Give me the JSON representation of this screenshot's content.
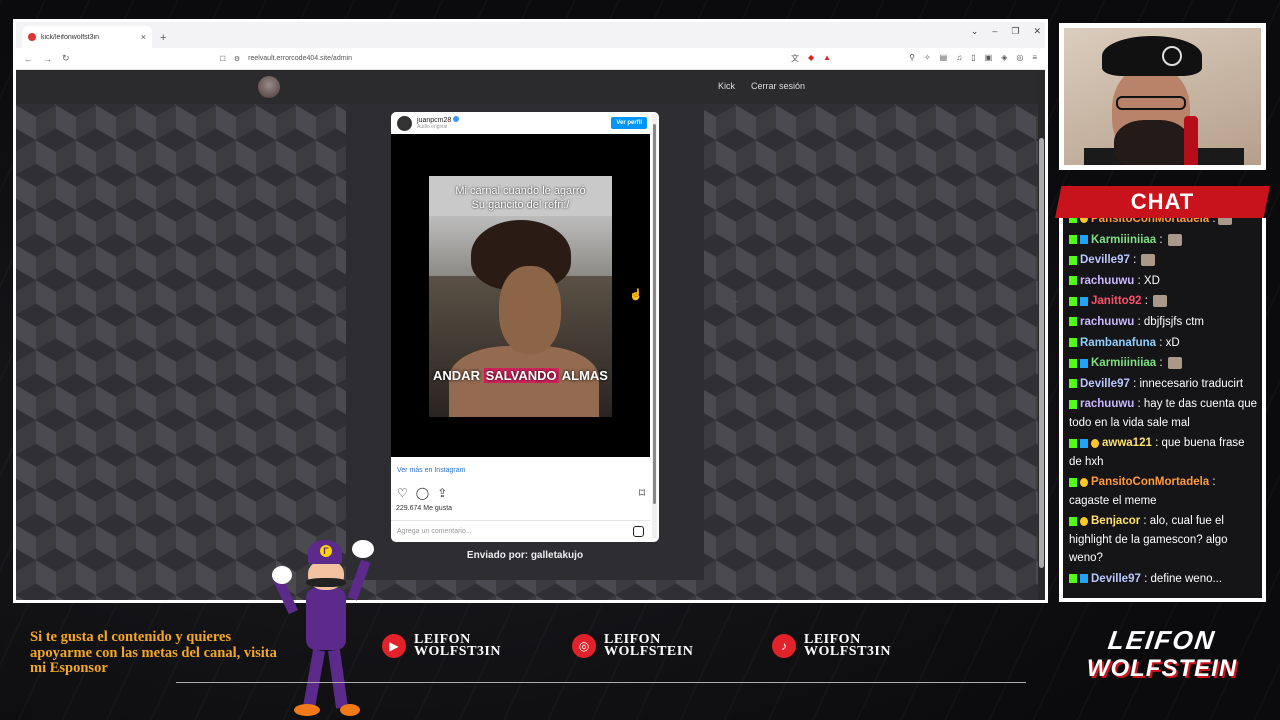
{
  "browser": {
    "tab_title": "kick/leifonwolfst3in",
    "url": "reelvault.errorcode404.site/admin",
    "new_tab": "+",
    "tab_close": "×"
  },
  "site": {
    "nav": [
      {
        "label": "Kick"
      },
      {
        "label": "Cerrar sesión"
      }
    ],
    "arrow_prev": "←",
    "arrow_next": "→",
    "sent_by": "Enviado por: galletakujo"
  },
  "instagram_embed": {
    "username": "juanpcm28",
    "audio": "Audio original",
    "view_profile": "Ver perfil",
    "caption_top_line1": "Mi carnal cuando le agarró",
    "caption_top_line2": "Su gancito del refri:/",
    "caption_bottom_pre": "ANDAR ",
    "caption_bottom_highlight": "SALVANDO",
    "caption_bottom_post": " ALMAS",
    "see_more": "Ver más en Instagram",
    "likes": "229.674 Me gusta",
    "comment_placeholder": "Agrega un comentario..."
  },
  "chat": {
    "title": "CHAT",
    "messages": [
      {
        "user": "PansitoConMortadela",
        "text": " :",
        "color": "#ff9a3c",
        "emote": true
      },
      {
        "user": "Karmiiiniiaa",
        "text": " : ",
        "color": "#7ee07e",
        "emote": true
      },
      {
        "user": "Deville97",
        "text": " : ",
        "color": "#b9c7ff",
        "emote": true
      },
      {
        "user": "rachuuwu",
        "text": " : XD",
        "color": "#c9b8ff",
        "emote": false
      },
      {
        "user": "Janitto92",
        "text": " : ",
        "color": "#ff4f6a",
        "emote": true
      },
      {
        "user": "rachuuwu",
        "text": " : dbjfjsjfs ctm",
        "color": "#c9b8ff",
        "emote": false
      },
      {
        "user": "Rambanafuna",
        "text": " : xD",
        "color": "#8fd0ff",
        "emote": false
      },
      {
        "user": "Karmiiiniiaa",
        "text": " : ",
        "color": "#7ee07e",
        "emote": true
      },
      {
        "user": "Deville97",
        "text": " : innecesario traducirt",
        "color": "#b9c7ff",
        "emote": false
      },
      {
        "user": "rachuuwu",
        "text": " : hay te das cuenta que todo en la vida sale mal",
        "color": "#c9b8ff",
        "emote": false
      },
      {
        "user": "awwa121",
        "text": " : que buena frase de hxh",
        "color": "#ffe070",
        "emote": false
      },
      {
        "user": "PansitoConMortadela",
        "text": " : cagaste el meme",
        "color": "#ff9a3c",
        "emote": false
      },
      {
        "user": "Benjacor",
        "text": " : alo, cual fue el highlight de la gamescon? algo weno?",
        "color": "#ffe070",
        "emote": false
      },
      {
        "user": "Deville97",
        "text": " : define weno...",
        "color": "#b9c7ff",
        "emote": false
      }
    ]
  },
  "overlay": {
    "sponsor_text": "Si te gusta el contenido y quieres apoyarme con las metas del canal, visita mi Esponsor",
    "socials": [
      {
        "icon": "youtube-icon",
        "line1": "LEIFON",
        "line2": "WOLFST3IN"
      },
      {
        "icon": "instagram-icon",
        "line1": "LEIFON",
        "line2": "WOLFSTEIN"
      },
      {
        "icon": "tiktok-icon",
        "line1": "LEIFON",
        "line2": "WOLFST3IN"
      }
    ],
    "brand_line1": "LEIFON",
    "brand_line2": "WOLFSTEIN"
  },
  "colors": {
    "accent_red": "#c8121c",
    "kick_green": "#53fc18",
    "sponsor_orange": "#f4a726",
    "instagram_blue": "#0095f6"
  }
}
